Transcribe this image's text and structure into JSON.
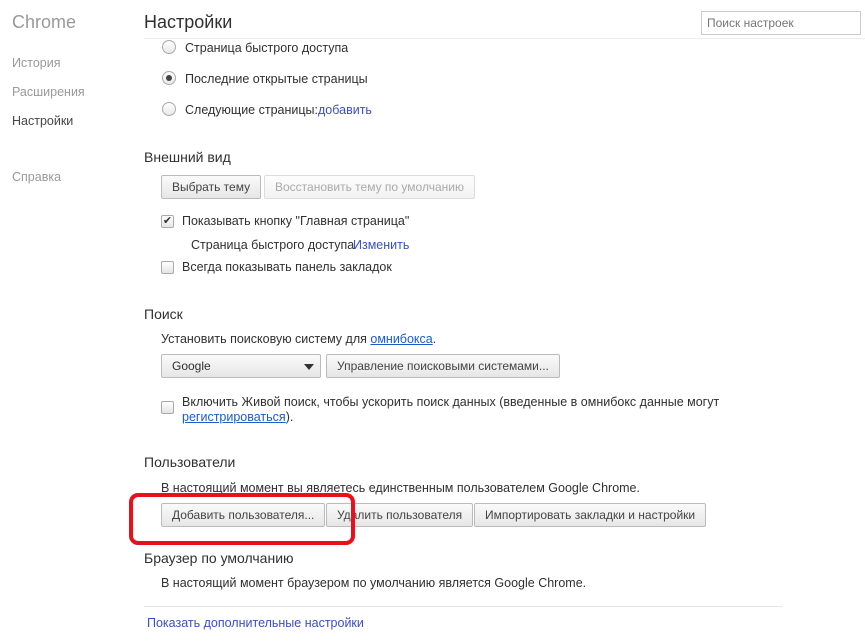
{
  "sidebar": {
    "brand": "Chrome",
    "items": [
      {
        "label": "История"
      },
      {
        "label": "Расширения"
      },
      {
        "label": "Настройки"
      },
      {
        "label": "Справка"
      }
    ]
  },
  "header": {
    "title": "Настройки",
    "search_placeholder": "Поиск настроек"
  },
  "startup": {
    "options": [
      {
        "label": "Страница быстрого доступа",
        "selected": false
      },
      {
        "label": "Последние открытые страницы",
        "selected": true
      },
      {
        "label": "Следующие страницы:",
        "selected": false
      }
    ],
    "add_link": "добавить"
  },
  "appearance": {
    "title": "Внешний вид",
    "choose_theme": "Выбрать тему",
    "reset_theme": "Восстановить тему по умолчанию",
    "show_home": "Показывать кнопку \"Главная страница\"",
    "show_home_checked": true,
    "home_page": "Страница быстрого доступа",
    "change_link": "Изменить",
    "show_bookmarks": "Всегда показывать панель закладок",
    "show_bookmarks_checked": false
  },
  "search": {
    "title": "Поиск",
    "desc": "Установить поисковую систему для ",
    "omnibox_link": "омнибокса",
    "desc_end": ".",
    "engine": "Google",
    "manage": "Управление поисковыми системами...",
    "instant": "Включить Живой поиск, чтобы ускорить поиск данных (введенные в омнибокс данные могут",
    "instant_link": "регистрироваться",
    "instant_end": ").",
    "instant_checked": false
  },
  "users": {
    "title": "Пользователи",
    "desc": "В настоящий момент вы являетесь единственным пользователем Google Chrome.",
    "add": "Добавить пользователя...",
    "delete": "Удалить пользователя",
    "import": "Импортировать закладки и настройки",
    "highlight_color": "#e8101b"
  },
  "default_browser": {
    "title": "Браузер по умолчанию",
    "desc": "В настоящий момент браузером по умолчанию является Google Chrome."
  },
  "footer": {
    "advanced_link": "Показать дополнительные настройки"
  }
}
